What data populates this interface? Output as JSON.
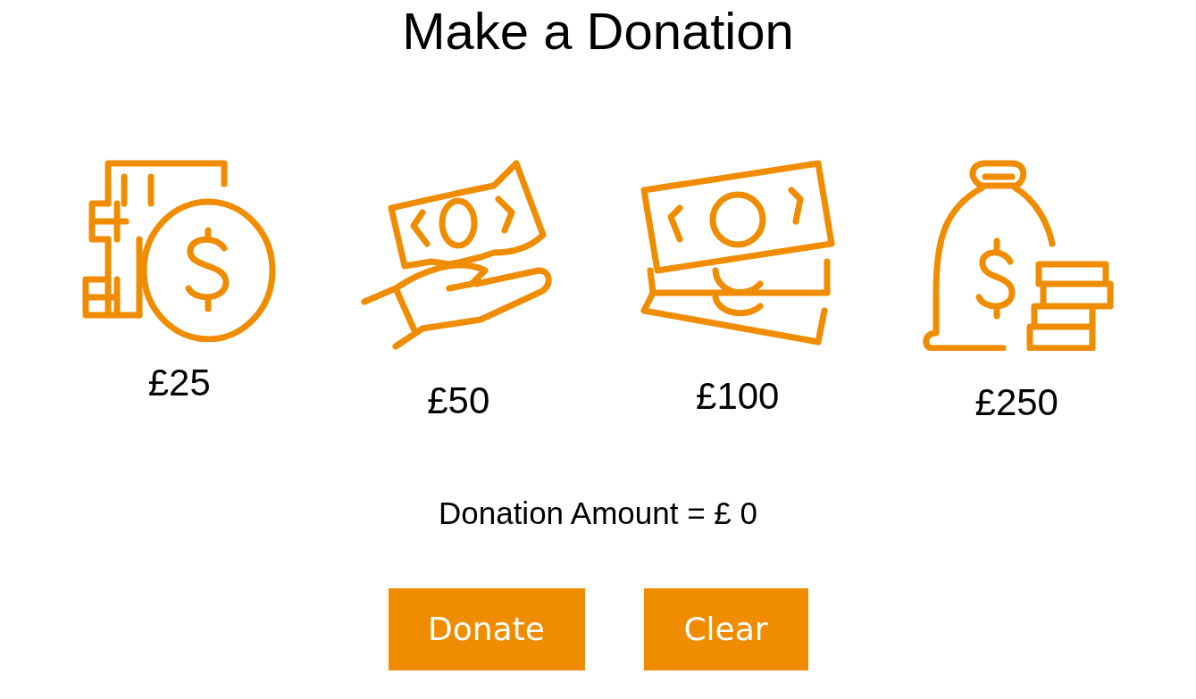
{
  "title": "Make a Donation",
  "options": [
    {
      "amount": "£25"
    },
    {
      "amount": "£50"
    },
    {
      "amount": "£100"
    },
    {
      "amount": "£250"
    }
  ],
  "total": "Donation Amount = £ 0",
  "buttons": [
    "Donate",
    "Clear"
  ]
}
